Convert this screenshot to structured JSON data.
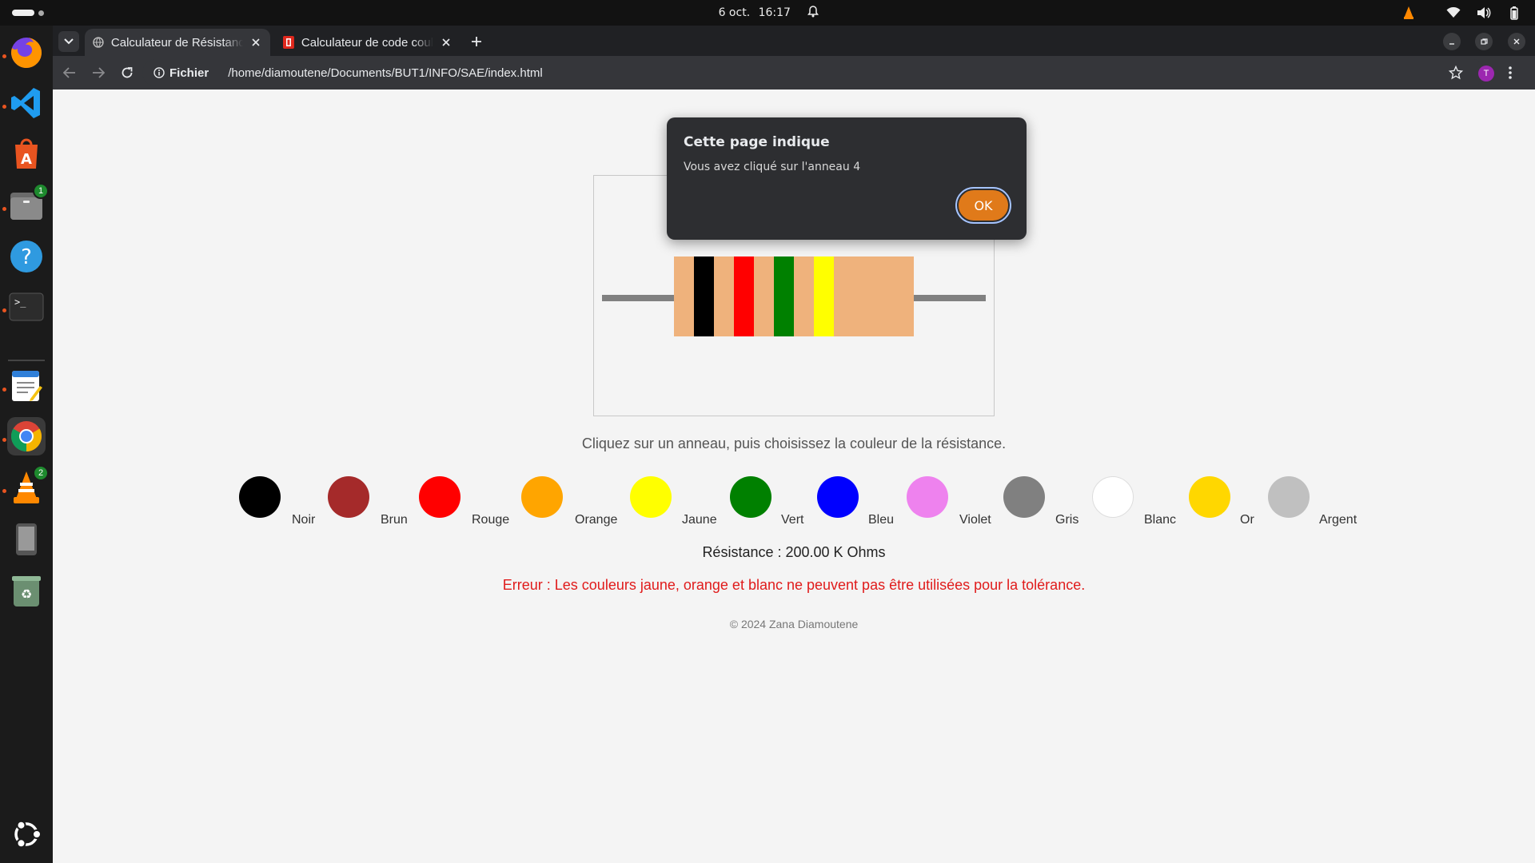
{
  "system": {
    "date": "6 oct.",
    "time": "16:17"
  },
  "dock": {
    "items": [
      {
        "name": "Firefox",
        "badge": ""
      },
      {
        "name": "Visual Studio Code",
        "badge": ""
      },
      {
        "name": "App Center",
        "badge": ""
      },
      {
        "name": "Files",
        "badge": "1"
      },
      {
        "name": "Help",
        "badge": ""
      },
      {
        "name": "Terminal",
        "badge": ""
      },
      {
        "name": "Text Editor",
        "badge": ""
      },
      {
        "name": "Google Chrome",
        "badge": ""
      },
      {
        "name": "VLC",
        "badge": "2"
      },
      {
        "name": "Phone",
        "badge": ""
      },
      {
        "name": "Trash",
        "badge": ""
      }
    ]
  },
  "browser": {
    "tabs": [
      {
        "title": "Calculateur de Résistance",
        "active": true
      },
      {
        "title": "Calculateur de code couleur",
        "active": false
      }
    ],
    "site_chip": "Fichier",
    "url": "/home/diamoutene/Documents/BUT1/INFO/SAE/index.html",
    "profile_initial": "T"
  },
  "page": {
    "resistor": {
      "body_color": "#efb27c",
      "bands": [
        "#000000",
        "#ff0000",
        "#008000",
        "#ffff00"
      ]
    },
    "instruction": "Cliquez sur un anneau, puis choisissez la couleur de la résistance.",
    "colors": [
      {
        "label": "Noir",
        "hex": "#000000"
      },
      {
        "label": "Brun",
        "hex": "#a52a2a"
      },
      {
        "label": "Rouge",
        "hex": "#ff0000"
      },
      {
        "label": "Orange",
        "hex": "#ffa500"
      },
      {
        "label": "Jaune",
        "hex": "#ffff00"
      },
      {
        "label": "Vert",
        "hex": "#008000"
      },
      {
        "label": "Bleu",
        "hex": "#0000ff"
      },
      {
        "label": "Violet",
        "hex": "#ee82ee"
      },
      {
        "label": "Gris",
        "hex": "#808080"
      },
      {
        "label": "Blanc",
        "hex": "#ffffff"
      },
      {
        "label": "Or",
        "hex": "#ffd700"
      },
      {
        "label": "Argent",
        "hex": "#c0c0c0"
      }
    ],
    "result": "Résistance : 200.00 K Ohms",
    "error": "Erreur : Les couleurs jaune, orange et blanc ne peuvent pas être utilisées pour la tolérance.",
    "footer": "© 2024 Zana Diamoutene"
  },
  "alert": {
    "title": "Cette page indique",
    "message": "Vous avez cliqué sur l'anneau 4",
    "ok_label": "OK"
  }
}
